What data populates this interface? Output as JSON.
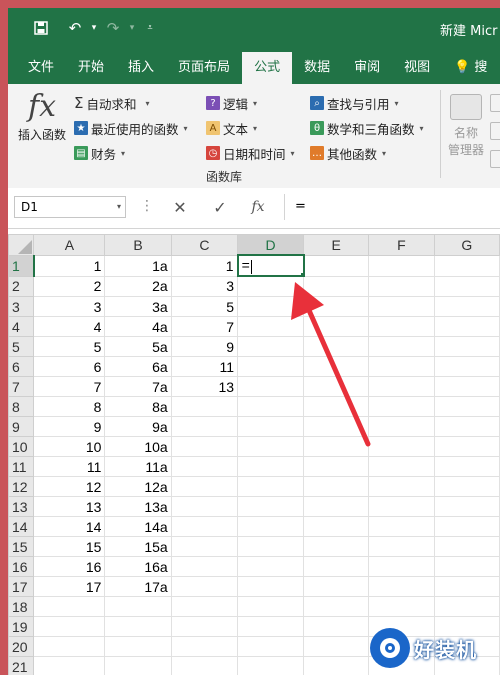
{
  "title_bar": {
    "doc_title": "新建 Micr"
  },
  "tabs": [
    "文件",
    "开始",
    "插入",
    "页面布局",
    "公式",
    "数据",
    "审阅",
    "视图"
  ],
  "active_tab": "公式",
  "search_tab_label": "搜",
  "ribbon": {
    "insert_function": "插入函数",
    "col1": [
      "自动求和",
      "最近使用的函数",
      "财务"
    ],
    "col2": [
      "逻辑",
      "文本",
      "日期和时间"
    ],
    "col3": [
      "查找与引用",
      "数学和三角函数",
      "其他函数"
    ],
    "group_label": "函数库",
    "names_label_1": "名称",
    "names_label_2": "管理器"
  },
  "formula_bar": {
    "name_box": "D1",
    "formula": "="
  },
  "columns": [
    "A",
    "B",
    "C",
    "D",
    "E",
    "F",
    "G"
  ],
  "selected_column": "D",
  "rows": [
    {
      "n": "1",
      "a": "1",
      "b": "1a",
      "c": "1",
      "d": "="
    },
    {
      "n": "2",
      "a": "2",
      "b": "2a",
      "c": "3",
      "d": ""
    },
    {
      "n": "3",
      "a": "3",
      "b": "3a",
      "c": "5",
      "d": ""
    },
    {
      "n": "4",
      "a": "4",
      "b": "4a",
      "c": "7",
      "d": ""
    },
    {
      "n": "5",
      "a": "5",
      "b": "5a",
      "c": "9",
      "d": ""
    },
    {
      "n": "6",
      "a": "6",
      "b": "6a",
      "c": "11",
      "d": ""
    },
    {
      "n": "7",
      "a": "7",
      "b": "7a",
      "c": "13",
      "d": ""
    },
    {
      "n": "8",
      "a": "8",
      "b": "8a",
      "c": "",
      "d": ""
    },
    {
      "n": "9",
      "a": "9",
      "b": "9a",
      "c": "",
      "d": ""
    },
    {
      "n": "10",
      "a": "10",
      "b": "10a",
      "c": "",
      "d": ""
    },
    {
      "n": "11",
      "a": "11",
      "b": "11a",
      "c": "",
      "d": ""
    },
    {
      "n": "12",
      "a": "12",
      "b": "12a",
      "c": "",
      "d": ""
    },
    {
      "n": "13",
      "a": "13",
      "b": "13a",
      "c": "",
      "d": ""
    },
    {
      "n": "14",
      "a": "14",
      "b": "14a",
      "c": "",
      "d": ""
    },
    {
      "n": "15",
      "a": "15",
      "b": "15a",
      "c": "",
      "d": ""
    },
    {
      "n": "16",
      "a": "16",
      "b": "16a",
      "c": "",
      "d": ""
    },
    {
      "n": "17",
      "a": "17",
      "b": "17a",
      "c": "",
      "d": ""
    },
    {
      "n": "18",
      "a": "",
      "b": "",
      "c": "",
      "d": ""
    },
    {
      "n": "19",
      "a": "",
      "b": "",
      "c": "",
      "d": ""
    },
    {
      "n": "20",
      "a": "",
      "b": "",
      "c": "",
      "d": ""
    },
    {
      "n": "21",
      "a": "",
      "b": "",
      "c": "",
      "d": ""
    }
  ],
  "watermark": "好装机",
  "colors": {
    "excel_green": "#217346",
    "annotation_red": "#e8303a"
  }
}
